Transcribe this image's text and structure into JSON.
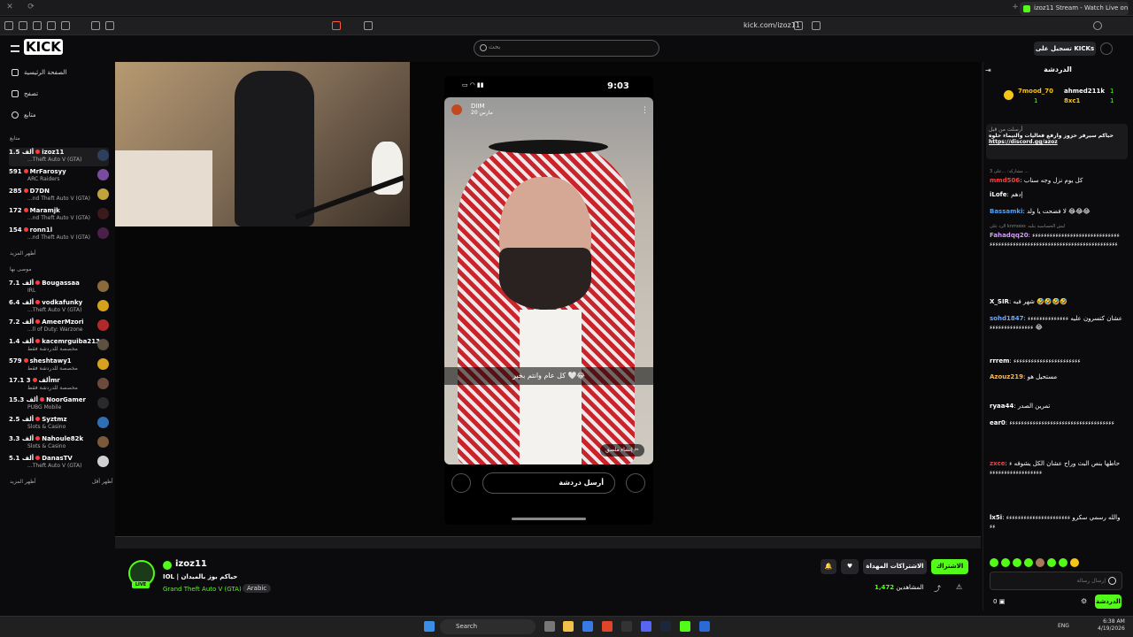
{
  "browser": {
    "tab_title": "izoz11 Stream - Watch Live on K",
    "url": "kick.com/izoz11"
  },
  "header": {
    "logo_text": "KICK",
    "search_placeholder": "بحث",
    "login_label": "تسجيل على KICKs"
  },
  "sidebar": {
    "nav": [
      {
        "label": "الصفحة الرئيسية",
        "icon": "home-icon"
      },
      {
        "label": "تصفح",
        "icon": "browse-icon"
      },
      {
        "label": "متابع",
        "icon": "heart-icon"
      }
    ],
    "following_title": "متابع",
    "following": [
      {
        "viewers": "1.5 ألف",
        "name": "izoz11",
        "game": "...Theft Auto V (GTA)"
      },
      {
        "viewers": "591",
        "name": "MrFarosyy",
        "game": "ARC Raiders"
      },
      {
        "viewers": "285",
        "name": "D7DN",
        "game": "...nd Theft Auto V (GTA)"
      },
      {
        "viewers": "172",
        "name": "Maramjk",
        "game": "...nd Theft Auto V (GTA)"
      },
      {
        "viewers": "154",
        "name": "ronn1l",
        "game": "...nd Theft Auto V (GTA)"
      }
    ],
    "show_more": "أظهر المزيد",
    "recommended_title": "موصى بها",
    "recommended": [
      {
        "viewers": "7.1 ألف",
        "name": "Bougassaa",
        "game": "IRL"
      },
      {
        "viewers": "6.4 ألف",
        "name": "vodkafunky",
        "game": "...Theft Auto V (GTA)"
      },
      {
        "viewers": "7.2 ألف",
        "name": "AmeerMzori",
        "game": "...ll of Duty: Warzone"
      },
      {
        "viewers": "1.4 ألف",
        "name": "kacemrguiba213",
        "game": "مخصصة للدردشة فقط"
      },
      {
        "viewers": "579",
        "name": "sheshtawy1",
        "game": "مخصصة للدردشة فقط"
      },
      {
        "viewers": "17.1 ألف",
        "name": "3mr",
        "game": "مخصصة للدردشة فقط"
      },
      {
        "viewers": "15.3 ألف",
        "name": "NoorGamer",
        "game": "PUBG Mobile"
      },
      {
        "viewers": "2.5 ألف",
        "name": "Syztmz",
        "game": "Slots & Casino"
      },
      {
        "viewers": "3.3 ألف",
        "name": "Nahoule82k",
        "game": "Slots & Casino"
      },
      {
        "viewers": "5.1 ألف",
        "name": "DanasTV",
        "game": "...Theft Auto V (GTA)"
      }
    ],
    "show_more_2": "أظهر المزيد",
    "show_less": "أظهر أقل"
  },
  "player": {
    "time": "9:03",
    "story_user": "DIIM",
    "story_date": "20 مارس",
    "caption": "كل عام وانتم بخير 🤍😂",
    "reply_placeholder": "أرسل دردشة",
    "create_sticker": "إنشاء ملصق"
  },
  "stream": {
    "streamer": "izoz11",
    "title": "IOL | حياكم بوز بالميدان",
    "game": "Grand Theft Auto V (GTA)",
    "language": "Arabic",
    "viewers": "1,472",
    "viewers_label": "المشاهدين",
    "follow_label": "الاشتراك",
    "gift_label": "الاشتراكات المهداة",
    "live_badge": "LIVE"
  },
  "chat": {
    "title": "الدردشة",
    "gifters": [
      {
        "name": "7mood_70",
        "count": "1"
      },
      {
        "name": "ahmed211k",
        "count": "1"
      },
      {
        "name": "8xc1",
        "count": "1"
      }
    ],
    "pinned_title": "أرسلت من قبل",
    "pinned_text": "حياكم سيرفر حزوز وارفع فعاليات والتيماء حلوه",
    "pinned_link": "https://discord.gg/azoz",
    "messages": [
      {
        "user": "mmd506",
        "color": "#ff3b3b",
        "text": "كل يوم نزل وجه سناب",
        "reply": "مشاركه: ...على 3 ..."
      },
      {
        "user": "iLofe",
        "color": "#ffffff",
        "text": "إدهم"
      },
      {
        "user": "Bassamki",
        "color": "#4aa3ff",
        "text": "لا فضحت يا ولد 😂😂😂"
      },
      {
        "user": "Fahadqq20",
        "color": "#d79bff",
        "text": "ءءءءءءءءءءءءءءءءءءءءءءءءءءءءءءءءءءءءءءءءءءءءءءءءءءءءءءءءءءءءءءءءءءءءءءءءءء",
        "reply": "الرد على knmooo: ليش الحساسية بتلبه"
      },
      {
        "user": "X_SIR",
        "color": "#ffffff",
        "text": "شهر فيه 🤣🤣🤣🤣"
      },
      {
        "user": "sohd1847",
        "color": "#6aa9ff",
        "text": "عشان كتسرون عليه ءءءءءءءءءءءءءءءءءءءءءءءءءءءءء 😂"
      },
      {
        "user": "rrrem",
        "color": "#ffffff",
        "text": "ءءءءءءءءءءءءءءءءءءءءءءء"
      },
      {
        "user": "Azouz219",
        "color": "#ffb84a",
        "text": "مستحيل هو"
      },
      {
        "user": "ryaa44",
        "color": "#ffffff",
        "text": "تمرين الصدر"
      },
      {
        "user": "ear0",
        "color": "#ffffff",
        "text": "ءءءءءءءءءءءءءءءءءءءءءءءءءءءءءءءءءءءء"
      },
      {
        "user": "zxce",
        "color": "#ff3b3b",
        "text": "حاطها بنص البث وراح عشان الكل يشوفه ءءءءءءءءءءءءءءءءءءء"
      },
      {
        "user": "lx5i",
        "color": "#ffffff",
        "text": "والله رسمي سكرو ءءءءءءءءءءءءءءءءءءءءءءءء"
      }
    ],
    "input_placeholder": "إرسال رسالة",
    "send_label": "الدردشة",
    "points": "0"
  },
  "os": {
    "search": "Search",
    "time": "6:38 AM",
    "date": "4/19/2026",
    "lang": "ENG"
  }
}
